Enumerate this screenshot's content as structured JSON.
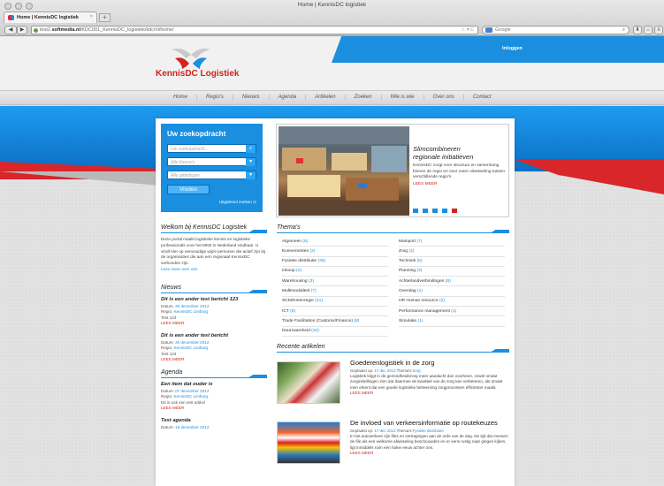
{
  "browser": {
    "window_title": "Home | KennisDC logistiek",
    "tab_title": "Home | KennisDC logistiek",
    "new_tab": "+",
    "url_prefix": "test2.",
    "url_host": "softmedia.nl",
    "url_path": "/KDC001_KennisDC_logistiek/kdc/nl/home/",
    "search_engine": "Google",
    "back": "◀",
    "forward": "▶"
  },
  "header": {
    "login": "Inloggen",
    "logo_text": "KennisDC Logistiek",
    "brand_red": "#d0241f",
    "brand_blue": "#1a8fe0"
  },
  "menu": [
    "Home",
    "Regio's",
    "Nieuws",
    "Agenda",
    "Artikelen",
    "Zoeken",
    "Wie is wie",
    "Over ons",
    "Contact"
  ],
  "search_box": {
    "title": "Uw zoekopdracht",
    "placeholder": "Uw zoekopdracht...",
    "themes_select": "Alle thema's",
    "departments_select": "Alle afdelingen",
    "find_button": "Vinden",
    "advanced_link": "Uitgebreid zoeken"
  },
  "slider": {
    "title_line1": "Slimcombineren",
    "title_line2": "regionale initiatieven",
    "text": "KennisDC zorgt voor structuur en samenhang binnen de regio en voor meer uitwisseling tussen verschillende regio's",
    "more": "LEES MEER"
  },
  "welcome": {
    "title": "Welkom bij KennisDC Logistiek",
    "text": "Deze portal maakt logistieke kennis en logistieke professionals voor het MKB in Nederland vindbaar. U vindt hier op eenvoudige wijze personen die actief zijn bij de organisaties die aan een regionaal KennisDC verbonden zijn.",
    "more": "Lees meer over ons"
  },
  "news": {
    "title": "Nieuws",
    "items": [
      {
        "title": "Dit is een ander test bericht 123",
        "date_label": "Datum:",
        "date": "20 december 2012",
        "region_label": "Regio:",
        "region": "KennisDC Limburg",
        "body": "Test 123",
        "more": "LEES MEER"
      },
      {
        "title": "Dit is een ander test bericht",
        "date_label": "Datum:",
        "date": "20 december 2012",
        "region_label": "Regio:",
        "region": "KennisDC Limburg",
        "body": "Test 123",
        "more": "LEES MEER"
      }
    ]
  },
  "agenda": {
    "title": "Agenda",
    "items": [
      {
        "title": "Een item dat ouder is",
        "date_label": "Datum:",
        "date": "07 december 2012",
        "region_label": "Regio:",
        "region": "KennisDC Limburg",
        "body": "Dit is ook een test artikel",
        "more": "LEES MEER"
      },
      {
        "title": "Test agenda",
        "date_label": "Datum:",
        "date": "18 december 2012"
      }
    ]
  },
  "themes": {
    "title": "Thema's",
    "left": [
      "Algemeen (6)",
      "Evenementen (2)",
      "Fysieke distributie (35)",
      "Inkoop (2)",
      "Warehousing (3)",
      "Multimodaliteit (7)",
      "SCM/Ketenregie (21)",
      "ICT (6)",
      "Trade Facilitation (Customs/Finance) (8)",
      "Duurzaamheid (20)"
    ],
    "right": [
      "Mainport (7)",
      "Zorg (2)",
      "Techniek (5)",
      "Planning (3)",
      "Achterlandverbindingen (8)",
      "Overslag (1)",
      "HR Human resource (2)",
      "Performance management (1)",
      "Simulatie (1)"
    ]
  },
  "articles": {
    "title": "Recente artikelen",
    "items": [
      {
        "title": "Goederenlogistiek in de zorg",
        "posted_label": "Geplaatst op:",
        "date": "17 dec 2012",
        "theme_label": "Thema's:",
        "theme": "Zorg",
        "text": "Logistiek krijgt in de gezondheidszorg meer aandacht dan voorheen, zowel omdat zorginstellingen zien dat daarmee de kwaliteit van de zorg kan verbeteren, als omdat men erkent dat een goede logistieke beheersing zorgprocessen efficiënter maakt.",
        "more": "LEES MEER"
      },
      {
        "title": "De invloed van verkeersinformatie op routekeuzes",
        "posted_label": "Geplaatst op:",
        "date": "17 dec 2012",
        "theme_label": "Thema's:",
        "theme": "Fysieke distributie",
        "text": "In het autoverkeer zijn files en vertragingen aan de orde van de dag. De tijd dat mensen de file als een welkome afwisseling beschouwden en er eens rustig naar gingen kijken, ligt inmiddels ruim een halve eeuw achter ons.",
        "more": "LEES MEER"
      }
    ]
  }
}
